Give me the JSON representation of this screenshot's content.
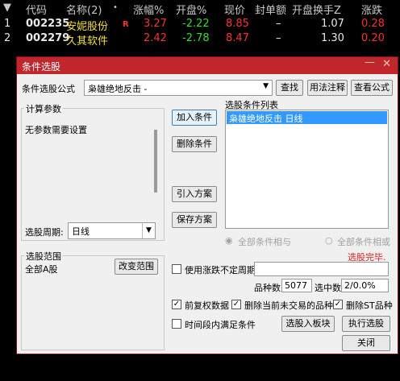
{
  "table": {
    "headers": [
      "代码",
      "名称(2)",
      "•",
      "涨幅%",
      "开盘%",
      "现价",
      "封单额",
      "开盘换手Z",
      "涨跌"
    ],
    "rows": [
      {
        "idx": "1",
        "code": "002235",
        "name": "安妮股份",
        "flag": "R",
        "chg": "3.27",
        "open": "-2.22",
        "price": "8.85",
        "seal": "–",
        "turn": "1.07",
        "diff": "0.28"
      },
      {
        "idx": "2",
        "code": "002279",
        "name": "久其软件",
        "flag": "",
        "chg": "2.42",
        "open": "-2.78",
        "price": "8.47",
        "seal": "–",
        "turn": "1.30",
        "diff": "0.20"
      }
    ]
  },
  "dialog": {
    "title": "条件选股",
    "formula_label": "条件选股公式",
    "formula_value": "枭雄绝地反击 -",
    "find_btn": "查找",
    "usage_btn": "用法注释",
    "view_btn": "查看公式",
    "calc_group": "计算参数",
    "no_params": "无参数需要设置",
    "add_btn": "加入条件",
    "del_btn": "删除条件",
    "cond_list_title": "选股条件列表",
    "cond_items": [
      "枭雄绝地反击  日线"
    ],
    "import_btn": "引入方案",
    "save_btn": "保存方案",
    "period_label": "选股周期:",
    "period_value": "日线",
    "radio_and": "全部条件相与",
    "radio_or": "全部条件相或",
    "range_group": "选股范围",
    "range_value": "全部A股",
    "change_range_btn": "改变范围",
    "status": "选股完毕.",
    "use_uncertain": "使用涨跌不定周期",
    "count_label": "品种数",
    "count_value": "5077",
    "selected_label": "选中数",
    "selected_value": "2/0.0%",
    "pre_adjust": "前复权数据",
    "del_untraded": "删除当前未交易的品种",
    "del_st": "删除ST品种",
    "time_range": "时间段内满足条件",
    "to_board_btn": "选股入板块",
    "run_btn": "执行选股",
    "close_btn": "关闭"
  },
  "colors": {
    "title_bar": "#c0272d",
    "status": "#e02020",
    "list_highlight": "#3399ff"
  }
}
